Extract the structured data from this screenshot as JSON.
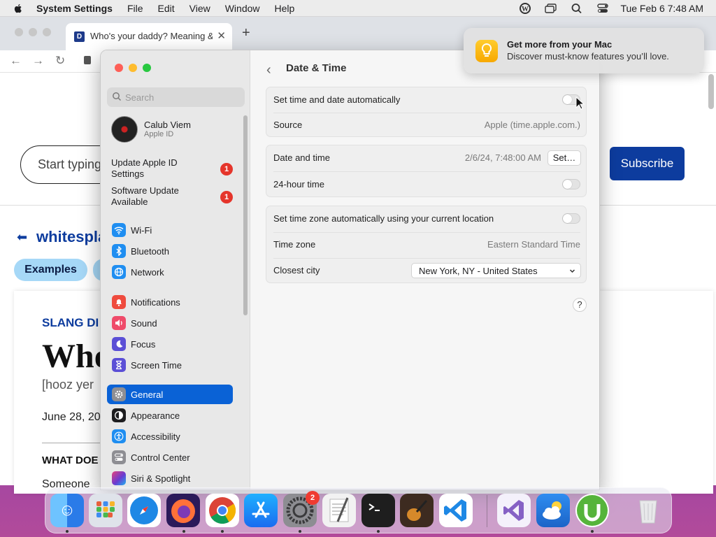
{
  "menubar": {
    "app": "System Settings",
    "items": [
      "File",
      "Edit",
      "View",
      "Window",
      "Help"
    ],
    "clock": "Tue Feb 6  7:48 AM"
  },
  "browser": {
    "tab_title": "Who's your daddy? Meaning &",
    "search_placeholder": "Start typing",
    "subscribe": "Subscribe",
    "section": "whitespla",
    "chip1": "Examples",
    "slang": "SLANG DI",
    "word": "Who",
    "pron": "[hooz yer",
    "date": "June 28, 201",
    "what": "WHAT DOE",
    "someone": "Someone"
  },
  "notification": {
    "title": "Get more from your Mac",
    "body": "Discover must-know features you’ll love."
  },
  "sidebar": {
    "search_placeholder": "Search",
    "account_name": "Calub Viem",
    "account_sub": "Apple ID",
    "alerts": [
      {
        "label": "Update Apple ID Settings",
        "count": "1"
      },
      {
        "label": "Software Update Available",
        "count": "1"
      }
    ],
    "items": [
      {
        "label": "Wi-Fi",
        "icon": "wifi-icon",
        "color": "#1f8ef1"
      },
      {
        "label": "Bluetooth",
        "icon": "bluetooth-icon",
        "color": "#1f8ef1"
      },
      {
        "label": "Network",
        "icon": "globe-icon",
        "color": "#1f8ef1"
      },
      {
        "label": "Notifications",
        "icon": "bell-icon",
        "color": "#ef4b3e"
      },
      {
        "label": "Sound",
        "icon": "speaker-icon",
        "color": "#ef4b6a"
      },
      {
        "label": "Focus",
        "icon": "moon-icon",
        "color": "#5b4fd6"
      },
      {
        "label": "Screen Time",
        "icon": "hourglass-icon",
        "color": "#5b4fd6"
      },
      {
        "label": "General",
        "icon": "gear-icon",
        "color": "#8e8e93"
      },
      {
        "label": "Appearance",
        "icon": "appearance-icon",
        "color": "#1d1d1f"
      },
      {
        "label": "Accessibility",
        "icon": "accessibility-icon",
        "color": "#1f8ef1"
      },
      {
        "label": "Control Center",
        "icon": "control-center-icon",
        "color": "#8e8e93"
      },
      {
        "label": "Siri & Spotlight",
        "icon": "siri-icon",
        "color": "#6a3ad1"
      }
    ],
    "selected": "General"
  },
  "content": {
    "title": "Date & Time",
    "rows": {
      "auto_time": "Set time and date automatically",
      "source_label": "Source",
      "source_value": "Apple (time.apple.com.)",
      "date_time_label": "Date and time",
      "date_time_value": "2/6/24, 7:48:00 AM",
      "set_button": "Set…",
      "hour24": "24-hour time",
      "auto_tz": "Set time zone automatically using your current location",
      "tz_label": "Time zone",
      "tz_value": "Eastern Standard Time",
      "city_label": "Closest city",
      "city_value": "New York, NY - United States"
    },
    "help": "?"
  },
  "dock": {
    "apps": [
      {
        "name": "Finder",
        "color": "#3a8ff0"
      },
      {
        "name": "Launchpad",
        "color": "#dfe3ea"
      },
      {
        "name": "Safari",
        "color": "#1e88e5"
      },
      {
        "name": "Firefox",
        "color": "#ff7139"
      },
      {
        "name": "Chrome",
        "color": "#ffffff"
      },
      {
        "name": "App Store",
        "color": "#1a8cff"
      },
      {
        "name": "System Settings",
        "color": "#8d8d92",
        "badge": "2"
      },
      {
        "name": "TextEdit",
        "color": "#f2f2f2"
      },
      {
        "name": "Terminal",
        "color": "#1e1e1e"
      },
      {
        "name": "GarageBand",
        "color": "#3d2b20"
      },
      {
        "name": "Visual Studio Code",
        "color": "#ffffff"
      },
      {
        "name": "Visual Studio",
        "color": "#f4f1fb"
      },
      {
        "name": "Weather",
        "color": "#2b7bd6"
      },
      {
        "name": "uTorrent",
        "color": "#56b43b"
      },
      {
        "name": "Trash",
        "color": "#eaeaea"
      }
    ]
  }
}
